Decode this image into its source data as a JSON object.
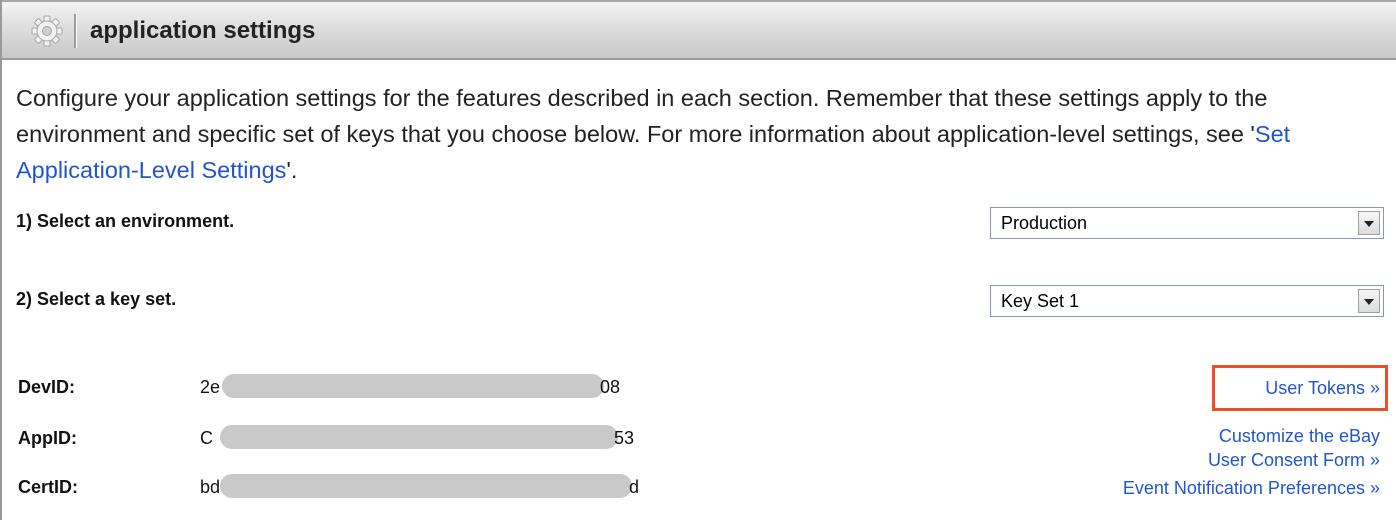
{
  "header": {
    "title": "application settings",
    "icon": "gear-icon"
  },
  "intro": {
    "text_before_link": "Configure your application settings for the features described in each section. Remember that these settings apply to the environment and specific set of keys that you choose below. For more information about application-level settings, see '",
    "link_text": "Set Application-Level Settings",
    "text_after_link": "'."
  },
  "step1": {
    "label": "1) Select an environment.",
    "selected": "Production"
  },
  "step2": {
    "label": "2) Select a key set.",
    "selected": "Key Set 1"
  },
  "keys": {
    "dev": {
      "label": "DevID:",
      "prefix": "2e",
      "suffix": "08"
    },
    "app": {
      "label": "AppID:",
      "prefix": "C",
      "suffix": "53"
    },
    "cert": {
      "label": "CertID:",
      "prefix": "bd",
      "suffix": "d"
    }
  },
  "links": {
    "user_tokens": "User Tokens »",
    "customize_line1": "Customize the eBay",
    "customize_line2": "User Consent Form »",
    "event_notification": "Event Notification Preferences »"
  },
  "colors": {
    "link": "#2255cc",
    "highlight": "#e8502c",
    "header_bg": "#dcdcdc",
    "mask": "#c9c9c9"
  }
}
